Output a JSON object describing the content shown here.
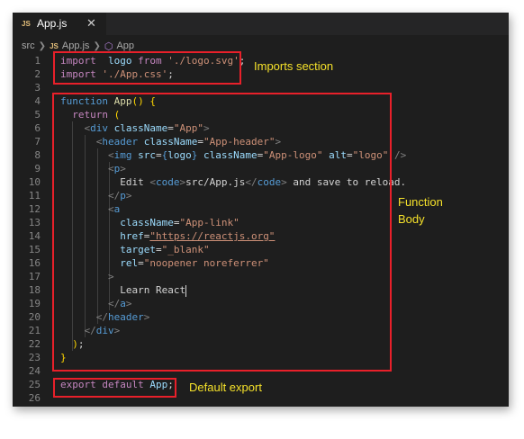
{
  "tab": {
    "icon": "JS",
    "name": "App.js",
    "close": "✕"
  },
  "breadcrumb": {
    "folder": "src",
    "icon": "JS",
    "file": "App.js",
    "symbol": "App"
  },
  "lines": [
    {
      "n": "1",
      "t": [
        [
          "kw",
          "import"
        ],
        [
          "",
          "  "
        ],
        [
          "vr",
          "logo"
        ],
        [
          "",
          " "
        ],
        [
          "kw",
          "from"
        ],
        [
          "",
          " "
        ],
        [
          "str",
          "'./logo.svg'"
        ],
        [
          "",
          ";"
        ]
      ]
    },
    {
      "n": "2",
      "t": [
        [
          "kw",
          "import"
        ],
        [
          "",
          " "
        ],
        [
          "str",
          "'./App.css'"
        ],
        [
          "",
          ";"
        ]
      ]
    },
    {
      "n": "3",
      "t": []
    },
    {
      "n": "4",
      "t": [
        [
          "kb",
          "function"
        ],
        [
          "",
          " "
        ],
        [
          "fn",
          "App"
        ],
        [
          "br",
          "("
        ],
        [
          "br",
          ")"
        ],
        [
          "",
          " "
        ],
        [
          "br",
          "{"
        ]
      ]
    },
    {
      "n": "5",
      "t": [
        [
          "",
          "  "
        ],
        [
          "kw",
          "return"
        ],
        [
          "",
          " "
        ],
        [
          "br",
          "("
        ]
      ]
    },
    {
      "n": "6",
      "t": [
        [
          "",
          "    "
        ],
        [
          "pn",
          "<"
        ],
        [
          "tg",
          "div"
        ],
        [
          "",
          " "
        ],
        [
          "at",
          "className"
        ],
        [
          "",
          "="
        ],
        [
          "str",
          "\"App\""
        ],
        [
          "pn",
          ">"
        ]
      ]
    },
    {
      "n": "7",
      "t": [
        [
          "",
          "      "
        ],
        [
          "pn",
          "<"
        ],
        [
          "tg",
          "header"
        ],
        [
          "",
          " "
        ],
        [
          "at",
          "className"
        ],
        [
          "",
          "="
        ],
        [
          "str",
          "\"App-header\""
        ],
        [
          "pn",
          ">"
        ]
      ]
    },
    {
      "n": "8",
      "t": [
        [
          "",
          "        "
        ],
        [
          "pn",
          "<"
        ],
        [
          "tg",
          "img"
        ],
        [
          "",
          " "
        ],
        [
          "at",
          "src"
        ],
        [
          "",
          "="
        ],
        [
          "kb",
          "{"
        ],
        [
          "vr",
          "logo"
        ],
        [
          "kb",
          "}"
        ],
        [
          "",
          " "
        ],
        [
          "at",
          "className"
        ],
        [
          "",
          "="
        ],
        [
          "str",
          "\"App-logo\""
        ],
        [
          "",
          " "
        ],
        [
          "at",
          "alt"
        ],
        [
          "",
          "="
        ],
        [
          "str",
          "\"logo\""
        ],
        [
          "",
          " "
        ],
        [
          "pn",
          "/>"
        ]
      ]
    },
    {
      "n": "9",
      "t": [
        [
          "",
          "        "
        ],
        [
          "pn",
          "<"
        ],
        [
          "tg",
          "p"
        ],
        [
          "pn",
          ">"
        ]
      ]
    },
    {
      "n": "10",
      "t": [
        [
          "",
          "          Edit "
        ],
        [
          "pn",
          "<"
        ],
        [
          "tg",
          "code"
        ],
        [
          "pn",
          ">"
        ],
        [
          "",
          "src/App.js"
        ],
        [
          "pn",
          "</"
        ],
        [
          "tg",
          "code"
        ],
        [
          "pn",
          ">"
        ],
        [
          "",
          " and save to reload."
        ]
      ]
    },
    {
      "n": "11",
      "t": [
        [
          "",
          "        "
        ],
        [
          "pn",
          "</"
        ],
        [
          "tg",
          "p"
        ],
        [
          "pn",
          ">"
        ]
      ]
    },
    {
      "n": "12",
      "t": [
        [
          "",
          "        "
        ],
        [
          "pn",
          "<"
        ],
        [
          "tg",
          "a"
        ]
      ]
    },
    {
      "n": "13",
      "t": [
        [
          "",
          "          "
        ],
        [
          "at",
          "className"
        ],
        [
          "",
          "="
        ],
        [
          "str",
          "\"App-link\""
        ]
      ]
    },
    {
      "n": "14",
      "t": [
        [
          "",
          "          "
        ],
        [
          "at",
          "href"
        ],
        [
          "",
          "="
        ],
        [
          "url",
          "\"https://reactjs.org\""
        ]
      ]
    },
    {
      "n": "15",
      "t": [
        [
          "",
          "          "
        ],
        [
          "at",
          "target"
        ],
        [
          "",
          "="
        ],
        [
          "str",
          "\"_blank\""
        ]
      ]
    },
    {
      "n": "16",
      "t": [
        [
          "",
          "          "
        ],
        [
          "at",
          "rel"
        ],
        [
          "",
          "="
        ],
        [
          "str",
          "\"noopener noreferrer\""
        ]
      ]
    },
    {
      "n": "17",
      "t": [
        [
          "",
          "        "
        ],
        [
          "pn",
          ">"
        ]
      ]
    },
    {
      "n": "18",
      "t": [
        [
          "",
          "          Learn React"
        ]
      ],
      "cursor": true
    },
    {
      "n": "19",
      "t": [
        [
          "",
          "        "
        ],
        [
          "pn",
          "</"
        ],
        [
          "tg",
          "a"
        ],
        [
          "pn",
          ">"
        ]
      ]
    },
    {
      "n": "20",
      "t": [
        [
          "",
          "      "
        ],
        [
          "pn",
          "</"
        ],
        [
          "tg",
          "header"
        ],
        [
          "pn",
          ">"
        ]
      ]
    },
    {
      "n": "21",
      "t": [
        [
          "",
          "    "
        ],
        [
          "pn",
          "</"
        ],
        [
          "tg",
          "div"
        ],
        [
          "pn",
          ">"
        ]
      ]
    },
    {
      "n": "22",
      "t": [
        [
          "",
          "  "
        ],
        [
          "br",
          ")"
        ],
        [
          "",
          ";"
        ]
      ]
    },
    {
      "n": "23",
      "t": [
        [
          "br",
          "}"
        ]
      ]
    },
    {
      "n": "24",
      "t": []
    },
    {
      "n": "25",
      "t": [
        [
          "kw",
          "export"
        ],
        [
          "",
          " "
        ],
        [
          "kw",
          "default"
        ],
        [
          "",
          " "
        ],
        [
          "vr",
          "App"
        ],
        [
          "",
          ";"
        ]
      ]
    },
    {
      "n": "26",
      "t": []
    }
  ],
  "annotations": {
    "imports": "Imports section",
    "function_body_1": "Function",
    "function_body_2": "Body",
    "default_export": "Default export"
  },
  "colors": {
    "highlight_box": "#e8202a",
    "annotation_text": "#f5e12a"
  }
}
